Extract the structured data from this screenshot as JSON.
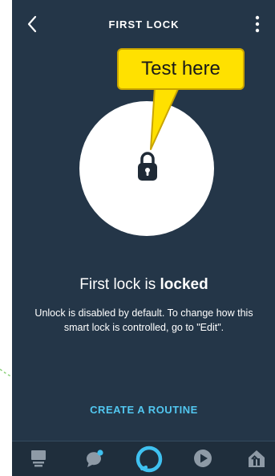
{
  "header": {
    "title": "FIRST LOCK",
    "back_icon": "chevron-left-icon",
    "more_icon": "more-vertical-icon"
  },
  "callout": {
    "text": "Test here"
  },
  "status": {
    "prefix": "First lock is ",
    "state": "locked"
  },
  "description": "Unlock is disabled by default. To change how this smart lock is controlled, go to \"Edit\".",
  "routine_link": "CREATE A ROUTINE",
  "bottom_nav": {
    "items": [
      {
        "icon": "devices-icon",
        "color": "#8e9aa6"
      },
      {
        "icon": "communicate-icon",
        "color": "#8e9aa6",
        "badge_color": "#3fc1f0"
      },
      {
        "icon": "alexa-ring-icon",
        "color": "#3fc1f0"
      },
      {
        "icon": "play-icon",
        "color": "#8e9aa6"
      },
      {
        "icon": "smart-home-icon",
        "color": "#8e9aa6"
      }
    ]
  },
  "colors": {
    "background": "#243648",
    "callout_fill": "#ffe100",
    "link": "#52c7f0",
    "alexa_accent": "#3fc1f0"
  }
}
